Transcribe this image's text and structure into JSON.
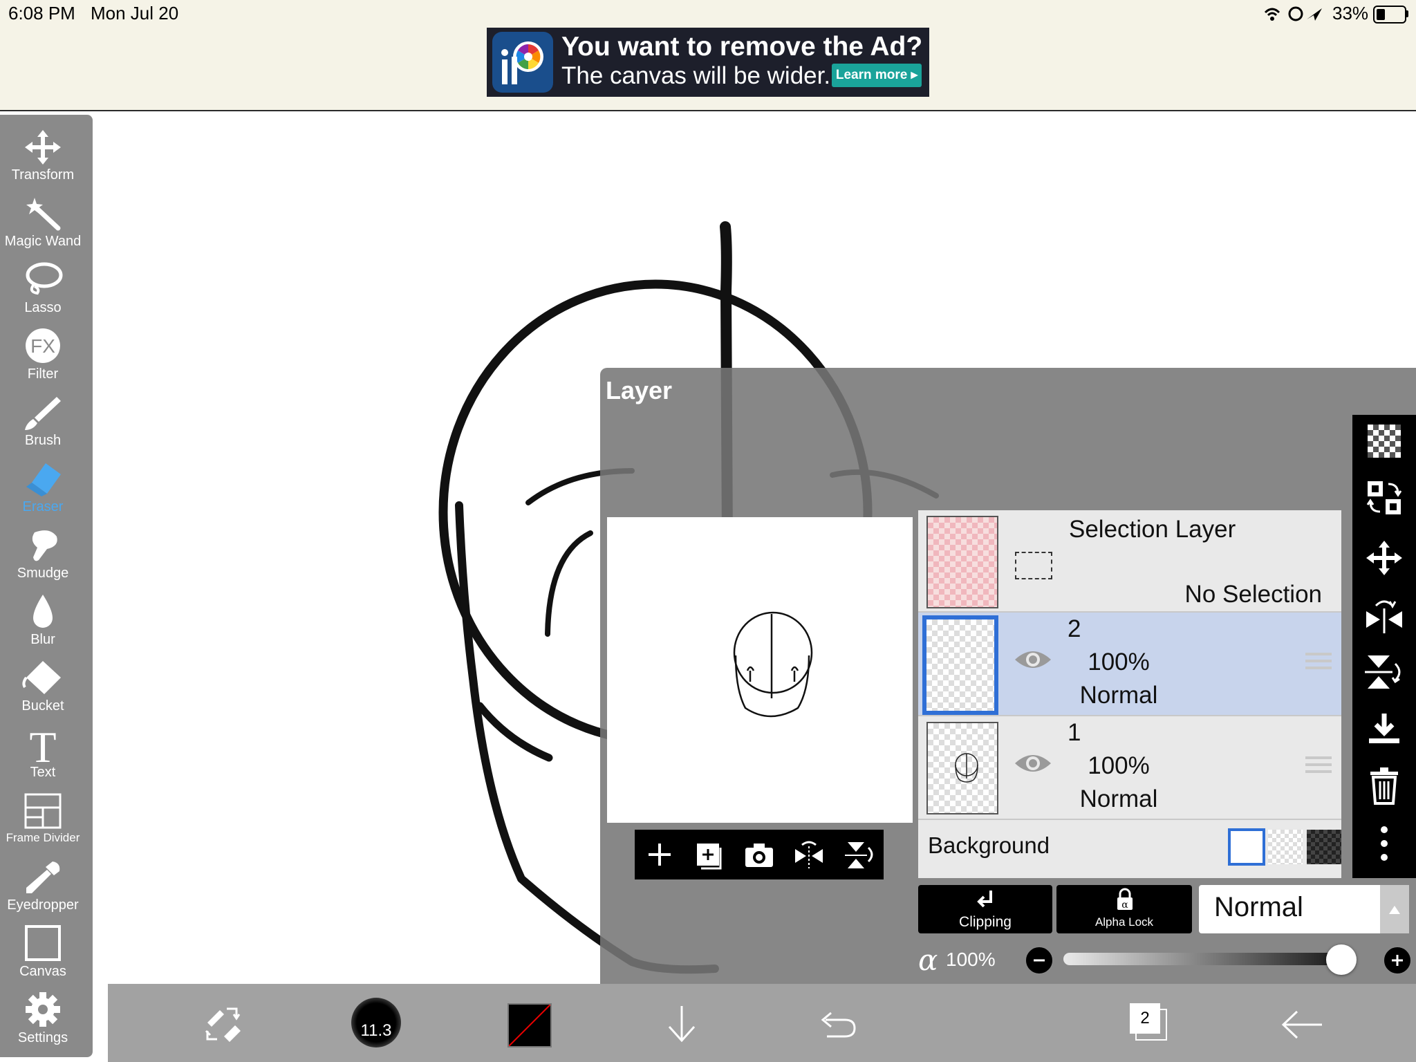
{
  "status_bar": {
    "time": "6:08 PM",
    "date": "Mon Jul 20",
    "battery": "33%"
  },
  "ad": {
    "title": "You want to remove the Ad?",
    "subtitle": "The canvas will be wider.",
    "button": "Learn more"
  },
  "tools": [
    {
      "label": "Transform",
      "icon": "move-arrows-icon"
    },
    {
      "label": "Magic Wand",
      "icon": "magic-wand-icon"
    },
    {
      "label": "Lasso",
      "icon": "lasso-icon"
    },
    {
      "label": "Filter",
      "icon": "fx-icon",
      "glyph": "FX"
    },
    {
      "label": "Brush",
      "icon": "brush-icon"
    },
    {
      "label": "Eraser",
      "icon": "eraser-icon",
      "active": true
    },
    {
      "label": "Smudge",
      "icon": "smudge-icon"
    },
    {
      "label": "Blur",
      "icon": "drop-icon"
    },
    {
      "label": "Bucket",
      "icon": "bucket-icon"
    },
    {
      "label": "Text",
      "icon": "text-icon",
      "glyph": "T"
    },
    {
      "label": "Frame Divider",
      "icon": "frame-divider-icon"
    },
    {
      "label": "Eyedropper",
      "icon": "eyedropper-icon"
    },
    {
      "label": "Canvas",
      "icon": "canvas-icon"
    },
    {
      "label": "Settings",
      "icon": "gear-icon"
    }
  ],
  "layer_panel": {
    "title": "Layer",
    "selection_layer": {
      "name": "Selection Layer",
      "status": "No Selection"
    },
    "layers": [
      {
        "name": "2",
        "opacity": "100%",
        "blend": "Normal",
        "selected": true
      },
      {
        "name": "1",
        "opacity": "100%",
        "blend": "Normal",
        "selected": false
      }
    ],
    "background_label": "Background",
    "clipping_label": "Clipping",
    "alpha_lock_label": "Alpha Lock",
    "blend_mode": "Normal",
    "alpha_symbol": "α",
    "opacity": "100%",
    "opacity_value": 1.0
  },
  "bottom_bar": {
    "brush_size": "11.3",
    "layer_count": "2"
  },
  "colors": {
    "accent": "#2f6fd6",
    "eraser_active": "#4aa8f0",
    "selected_row": "#c8d4ec",
    "primary_color": "#000000"
  }
}
